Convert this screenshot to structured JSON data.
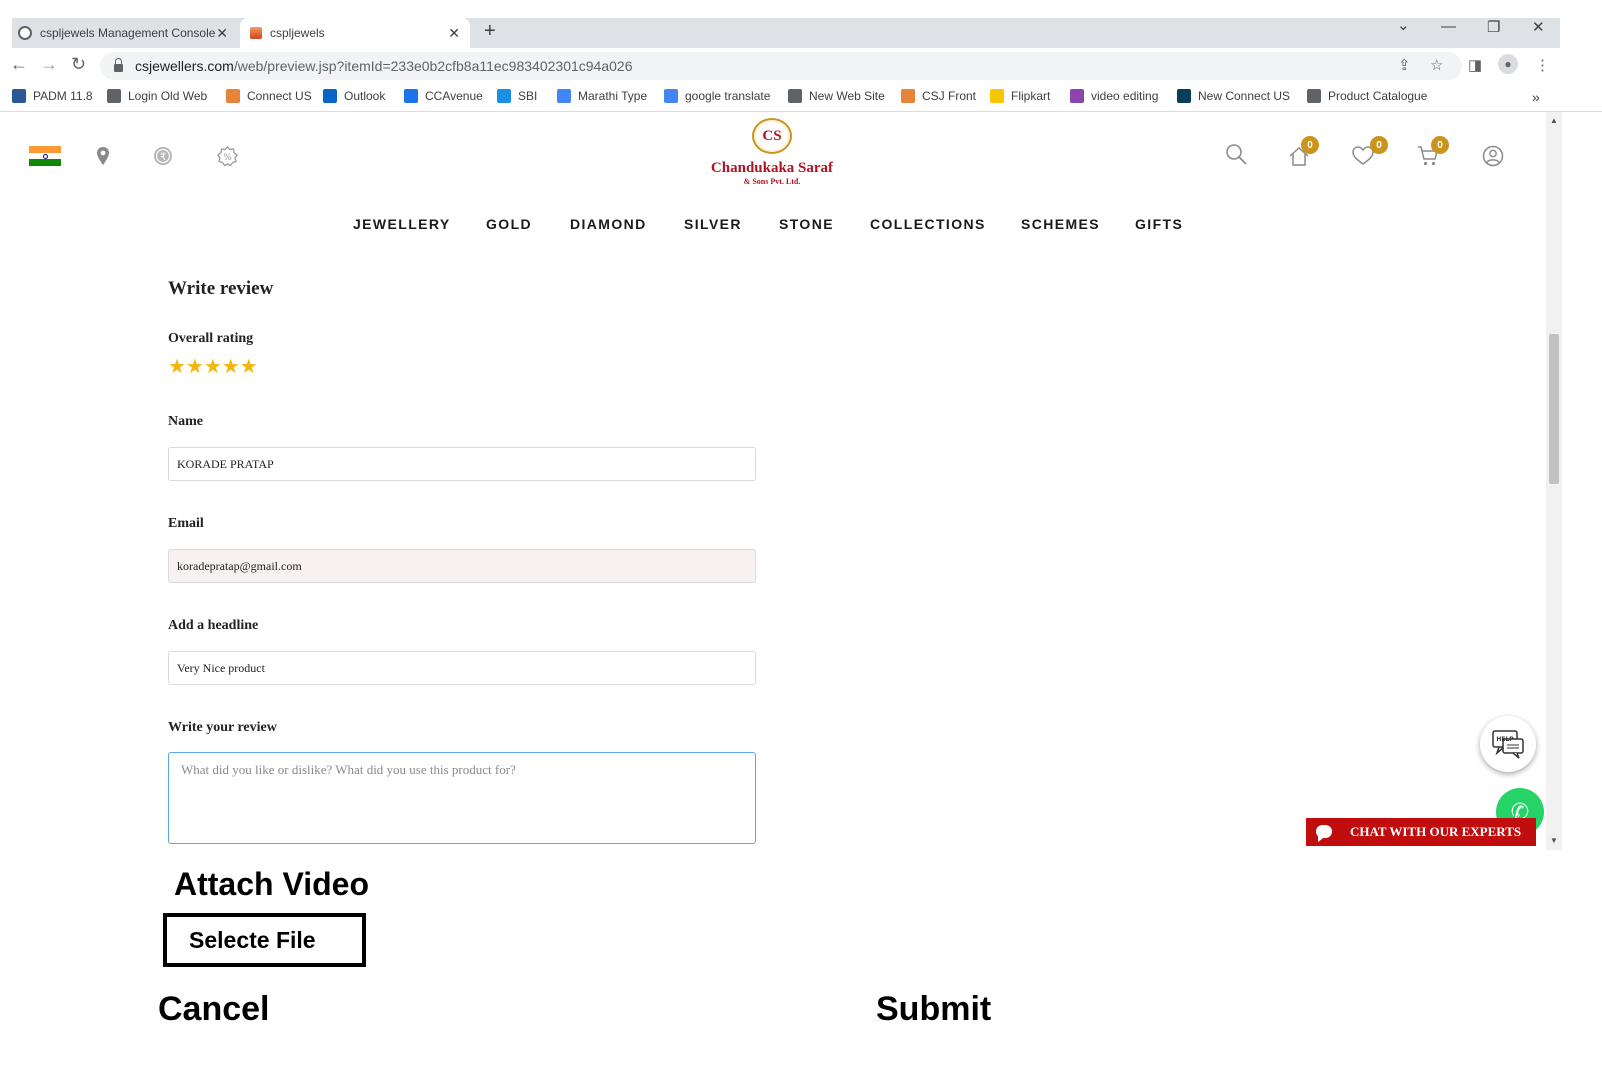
{
  "browser": {
    "tabs": [
      {
        "title": "cspljewels Management Console"
      },
      {
        "title": "cspljewels"
      }
    ],
    "new_tab": "+",
    "window_controls": {
      "minimize": "—",
      "restore": "❐",
      "close": "✕",
      "tab_list": "⌄"
    },
    "url_domain": "csjewellers.com",
    "url_path": "/web/preview.jsp?itemId=233e0b2cfb8a11ec983402301c94a026",
    "bookmarks": [
      {
        "label": "PADM 11.8",
        "color": "#2b5797"
      },
      {
        "label": "Login Old Web",
        "color": "#5f6368"
      },
      {
        "label": "Connect US",
        "color": "#e8833a"
      },
      {
        "label": "Outlook",
        "color": "#0a64c8"
      },
      {
        "label": "CCAvenue",
        "color": "#1a73e8"
      },
      {
        "label": "SBI",
        "color": "#1a8fe3"
      },
      {
        "label": "Marathi Type",
        "color": "#4285f4"
      },
      {
        "label": "google translate",
        "color": "#4285f4"
      },
      {
        "label": "New Web Site",
        "color": "#5f6368"
      },
      {
        "label": "CSJ Front",
        "color": "#e8833a"
      },
      {
        "label": "Flipkart",
        "color": "#f7c600"
      },
      {
        "label": "video editing",
        "color": "#8e44ad"
      },
      {
        "label": "New Connect US",
        "color": "#0b3d5c"
      },
      {
        "label": "Product Catalogue",
        "color": "#5f6368"
      }
    ],
    "bookmarks_more": "»"
  },
  "site": {
    "logo_mark": "CS",
    "logo_name": "Chandukaka Saraf",
    "logo_sub": "& Sons Pvt. Ltd.",
    "badges": {
      "home": "0",
      "wishlist": "0",
      "cart": "0"
    },
    "nav": [
      "JEWELLERY",
      "GOLD",
      "DIAMOND",
      "SILVER",
      "STONE",
      "COLLECTIONS",
      "SCHEMES",
      "GIFTS"
    ]
  },
  "review": {
    "title": "Write review",
    "rating_label": "Overall rating",
    "rating": 5,
    "rating_max": 5,
    "stars": "★★★★★",
    "name_label": "Name",
    "name_value": "KORADE PRATAP",
    "email_label": "Email",
    "email_value": "koradepratap@gmail.com",
    "headline_label": "Add a headline",
    "headline_value": "Very Nice product",
    "review_label": "Write your review",
    "review_placeholder": "What did you like or dislike? What did you use this product for?"
  },
  "widgets": {
    "help": "HELP",
    "chat": "CHAT WITH OUR EXPERTS"
  },
  "actions": {
    "attach_title": "Attach Video",
    "select_file": "Selecte File",
    "cancel": "Cancel",
    "submit": "Submit"
  },
  "colors": {
    "brand_red": "#b01323",
    "brand_gold": "#c9951f",
    "star": "#f5b50a",
    "chat_red": "#c00d0d"
  }
}
